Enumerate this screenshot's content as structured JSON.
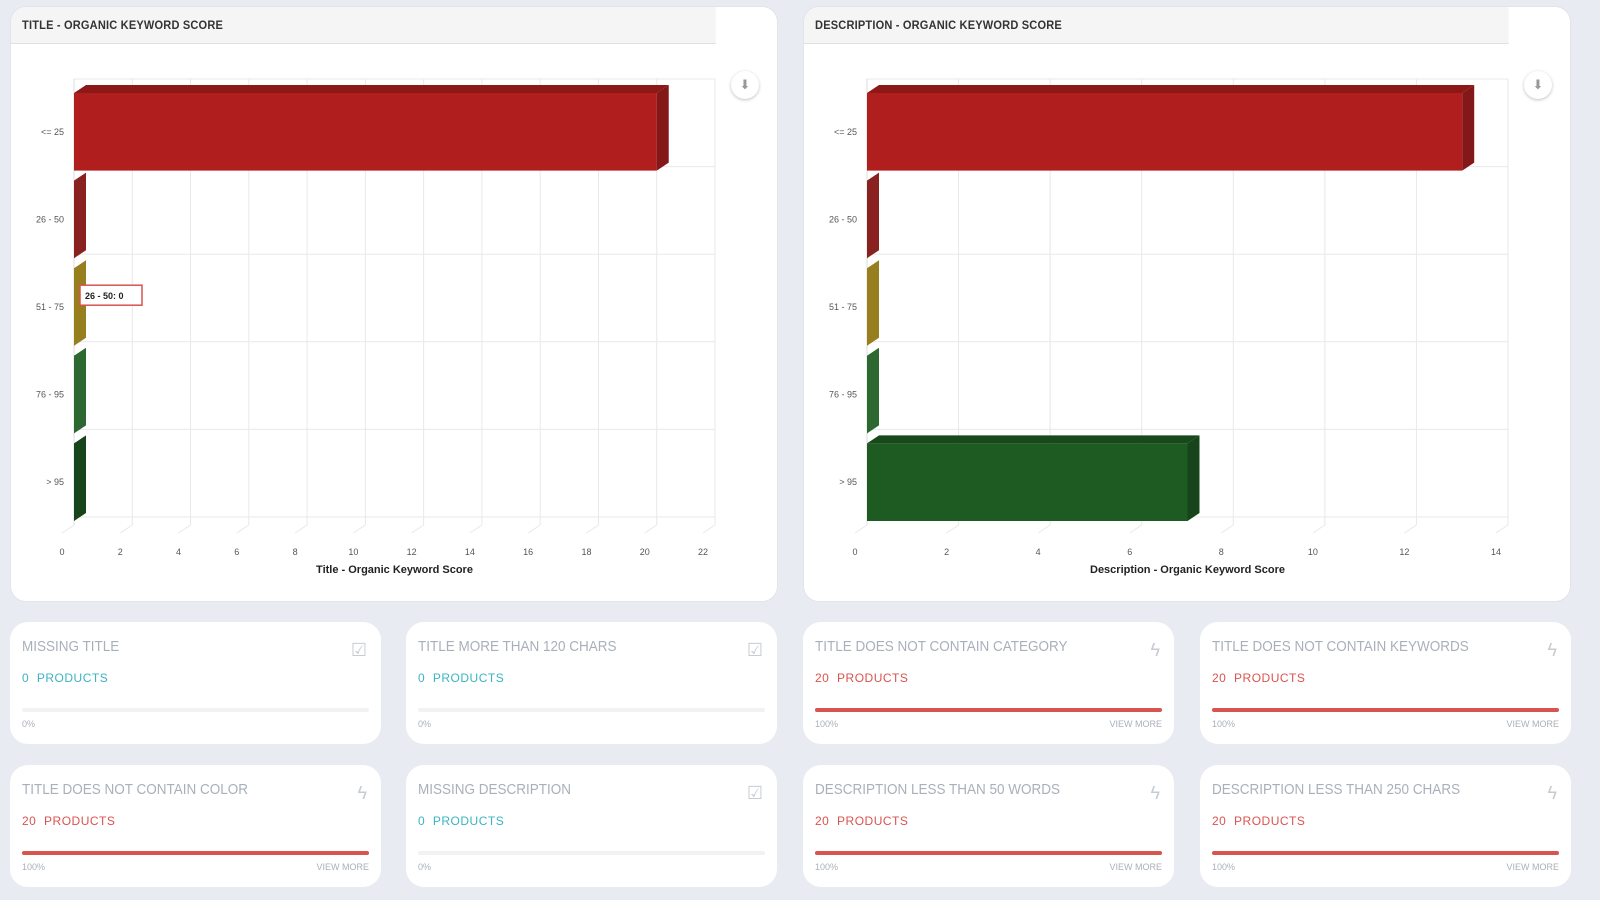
{
  "chart_data": [
    {
      "type": "bar",
      "orientation": "horizontal",
      "title": "TITLE - ORGANIC KEYWORD SCORE",
      "xlabel": "Title - Organic Keyword Score",
      "categories": [
        "<= 25",
        "26 - 50",
        "51 - 75",
        "76 - 95",
        "> 95"
      ],
      "values": [
        20,
        0,
        0,
        0,
        0
      ],
      "colors": [
        "#b01e1e",
        "#b82c2c",
        "#c9a92a",
        "#3a8a3e",
        "#1e5b22"
      ],
      "xlim": [
        0,
        22
      ],
      "xticks": [
        "0",
        "2",
        "4",
        "6",
        "8",
        "10",
        "12",
        "14",
        "16",
        "18",
        "20",
        "22"
      ],
      "grid": true,
      "tooltip": "26 - 50: 0"
    },
    {
      "type": "bar",
      "orientation": "horizontal",
      "title": "DESCRIPTION - ORGANIC KEYWORD SCORE",
      "xlabel": "Description - Organic Keyword Score",
      "categories": [
        "<= 25",
        "26 - 50",
        "51 - 75",
        "76 - 95",
        "> 95"
      ],
      "values": [
        13,
        0,
        0,
        0,
        7
      ],
      "colors": [
        "#b01e1e",
        "#b82c2c",
        "#c9a92a",
        "#3a8a3e",
        "#1e5b22"
      ],
      "xlim": [
        0,
        14
      ],
      "xticks": [
        "0",
        "2",
        "4",
        "6",
        "8",
        "10",
        "12",
        "14"
      ],
      "grid": true
    }
  ],
  "cards": [
    {
      "title": "MISSING TITLE",
      "count": "0",
      "unit": "PRODUCTS",
      "percent": "0%",
      "fill": 0,
      "icon": "check-square-icon",
      "status": "ok"
    },
    {
      "title": "TITLE MORE THAN 120 CHARS",
      "count": "0",
      "unit": "PRODUCTS",
      "percent": "0%",
      "fill": 0,
      "icon": "check-square-icon",
      "status": "ok"
    },
    {
      "title": "TITLE DOES NOT CONTAIN CATEGORY",
      "count": "20",
      "unit": "PRODUCTS",
      "percent": "100%",
      "fill": 100,
      "icon": "bolt-icon",
      "status": "bad",
      "link": "VIEW MORE"
    },
    {
      "title": "TITLE DOES NOT CONTAIN KEYWORDS",
      "count": "20",
      "unit": "PRODUCTS",
      "percent": "100%",
      "fill": 100,
      "icon": "bolt-icon",
      "status": "bad",
      "link": "VIEW MORE"
    },
    {
      "title": "TITLE DOES NOT CONTAIN COLOR",
      "count": "20",
      "unit": "PRODUCTS",
      "percent": "100%",
      "fill": 100,
      "icon": "bolt-icon",
      "status": "bad",
      "link": "VIEW MORE"
    },
    {
      "title": "MISSING DESCRIPTION",
      "count": "0",
      "unit": "PRODUCTS",
      "percent": "0%",
      "fill": 0,
      "icon": "check-square-icon",
      "status": "ok"
    },
    {
      "title": "DESCRIPTION LESS THAN 50 WORDS",
      "count": "20",
      "unit": "PRODUCTS",
      "percent": "100%",
      "fill": 100,
      "icon": "bolt-icon",
      "status": "bad",
      "link": "VIEW MORE"
    },
    {
      "title": "DESCRIPTION LESS THAN 250 CHARS",
      "count": "20",
      "unit": "PRODUCTS",
      "percent": "100%",
      "fill": 100,
      "icon": "bolt-icon",
      "status": "bad",
      "link": "VIEW MORE"
    }
  ],
  "colors": {
    "ok": "#3bb3c3",
    "bad": "#d9534f"
  }
}
